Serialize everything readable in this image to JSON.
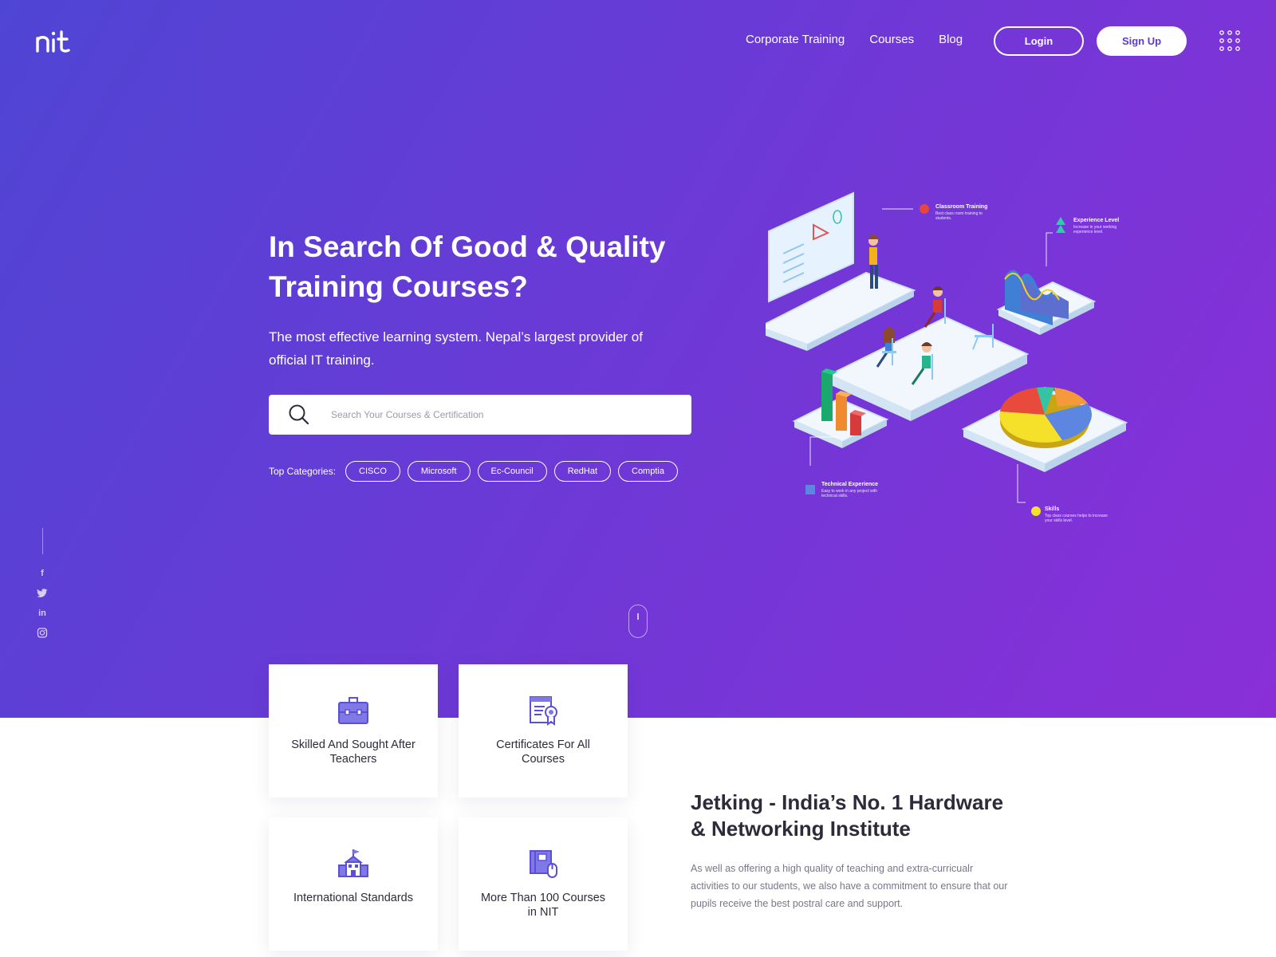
{
  "brand": {
    "logo_text": "nit"
  },
  "nav": {
    "links": [
      "Corporate Training",
      "Courses",
      "Blog"
    ],
    "login_label": "Login",
    "signup_label": "Sign Up"
  },
  "hero": {
    "title": "In Search Of Good & Quality Training Courses?",
    "subtitle": "The most effective learning system. Nepal’s largest provider of official IT training.",
    "search_placeholder": "Search Your Courses & Certification",
    "categories_label": "Top Categories:",
    "categories": [
      "CISCO",
      "Microsoft",
      "Ec-Council",
      "RedHat",
      "Comptia"
    ]
  },
  "illustration": {
    "labels": [
      {
        "title": "Classroom Training",
        "desc": "Best class room training to students."
      },
      {
        "title": "Experience Level",
        "desc": "Increase in your working experience level."
      },
      {
        "title": "Technical Experience",
        "desc": "Easy to work in any project with technical skills."
      },
      {
        "title": "Skills",
        "desc": "Top class courses helps to increase your skills level."
      }
    ]
  },
  "social": {
    "icons": [
      "facebook-icon",
      "twitter-icon",
      "linkedin-icon",
      "instagram-icon"
    ]
  },
  "features": [
    {
      "icon": "briefcase-icon",
      "text": "Skilled And Sought After Teachers"
    },
    {
      "icon": "certificate-icon",
      "text": "Certificates For All Courses"
    },
    {
      "icon": "school-building-icon",
      "text": "International Standards"
    },
    {
      "icon": "book-mouse-icon",
      "text": "More Than 100 Courses in NIT"
    }
  ],
  "about": {
    "title": "Jetking - India’s No. 1 Hardware & Networking Institute",
    "text": "As well as offering a high quality of teaching and extra-curricualr activities to our students, we also have a commitment to ensure that our pupils receive the best postral care and support."
  },
  "colors": {
    "hero_gradient_start": "#4f45d4",
    "hero_gradient_end": "#8a2fd8",
    "accent": "#5a3ad8",
    "icon": "#5b4fd6"
  }
}
